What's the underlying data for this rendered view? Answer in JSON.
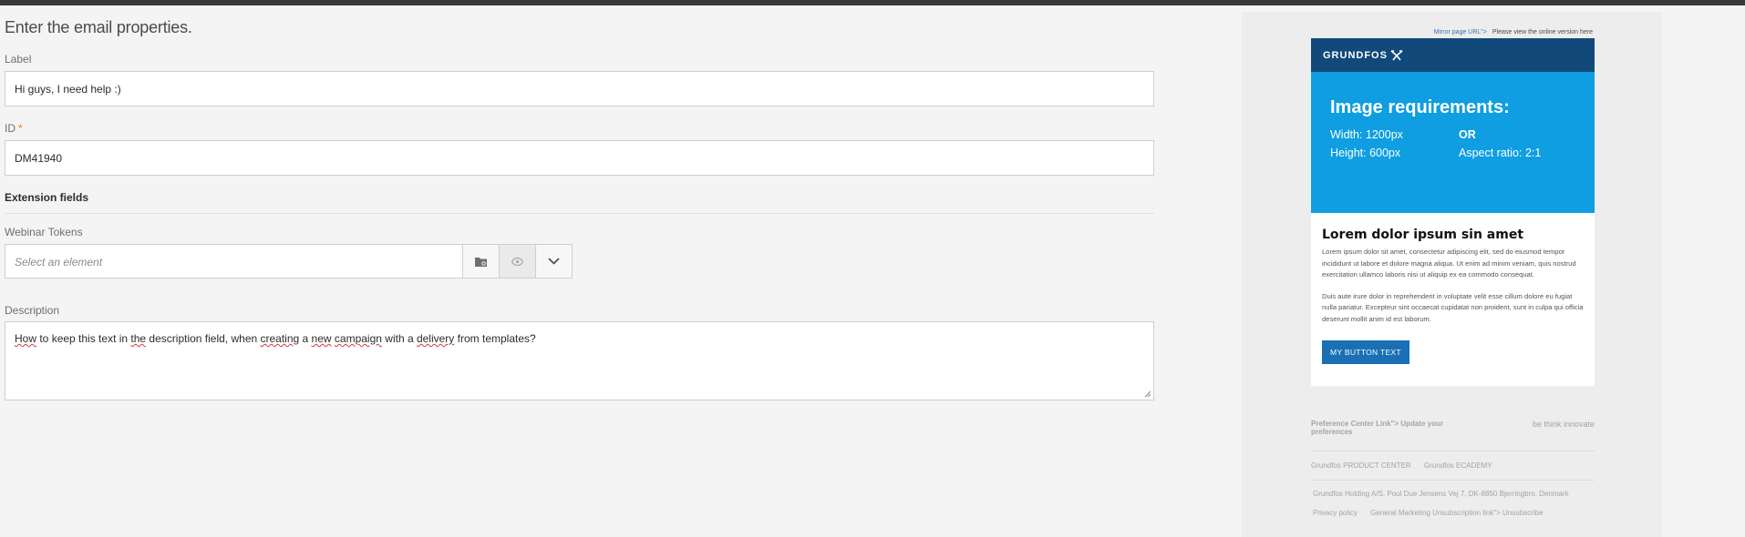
{
  "form": {
    "heading": "Enter the email properties.",
    "label_caption": "Label",
    "label_value": "Hi guys, I need help :)",
    "id_caption": "ID",
    "id_required": "*",
    "id_value": "DM41940",
    "section_title": "Extension fields",
    "webinar_caption": "Webinar Tokens",
    "webinar_placeholder": "Select an element",
    "description_caption": "Description",
    "description_words": [
      "How",
      " to keep this text in ",
      "the",
      " description field, when ",
      "creating",
      " a ",
      "new",
      " ",
      "campaign",
      " with a ",
      "delivery",
      " from templates?"
    ]
  },
  "preview": {
    "mirror_link": "Mirror page URL\">",
    "online_text": "Please view the online version here",
    "brand": "GRUNDFOS",
    "hero_title": "Image requirements:",
    "width": "Width: 1200px",
    "or": "OR",
    "height": "Height: 600px",
    "aspect": "Aspect ratio: 2:1",
    "lorem_title": "Lorem dolor ipsum sin amet",
    "para1": "Lorem ipsum dolor sit amet, consectetur adipiscing elit, sed do eiusmod tempor incididunt ut labore et dolore magna aliqua. Ut enim ad minim veniam, quis nostrud exercitation ullamco laboris nisi ut aliquip ex ea commodo consequat.",
    "para2": "Duis aute irure dolor in reprehenderit in voluptate velit esse cillum dolore eu fugiat nulla pariatur. Excepteur sint occaecat cupidatat non proident, sunt in culpa qui officia deserunt mollit anim id est laborum.",
    "button_text": "MY BUTTON TEXT",
    "pref_link": "Preference Center Link\"> Update your preferences",
    "slogan": "be think innovate",
    "product_center": "Grundfos PRODUCT CENTER",
    "academy": "Grundfos ECADEMY",
    "address": "Grundfos Holding A/S, Poul Due Jensens Vej 7, DK-8850 Bjerringbro, Denmark",
    "privacy": "Privacy policy",
    "unsubscribe": "General Marketing Unsubscription link\"> Unsubscribe"
  },
  "colors": {
    "accent_required": "#e68619",
    "brand_navy": "#11497b",
    "hero_blue": "#0f9ee1",
    "button_blue": "#1a6fb5"
  }
}
